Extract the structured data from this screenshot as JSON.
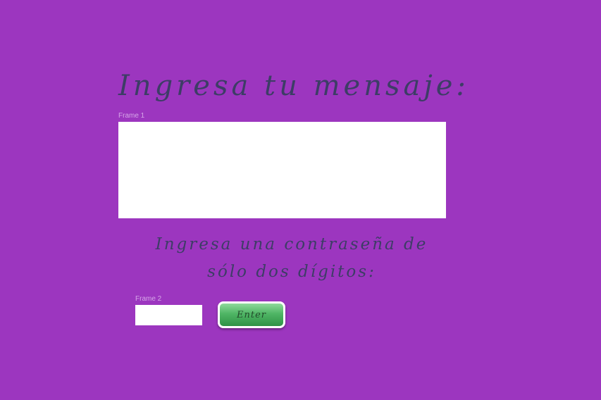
{
  "main": {
    "title": "Ingresa tu mensaje:",
    "frame1_label": "Frame 1",
    "message_value": "",
    "subtitle": "Ingresa una contraseña de sólo dos dígitos:",
    "frame2_label": "Frame 2",
    "password_value": "",
    "enter_label": "Enter"
  },
  "colors": {
    "background": "#9c36bf",
    "heading_text": "#3d3d66",
    "frame_label": "#d6a6e8",
    "button_green": "#4fb565"
  }
}
